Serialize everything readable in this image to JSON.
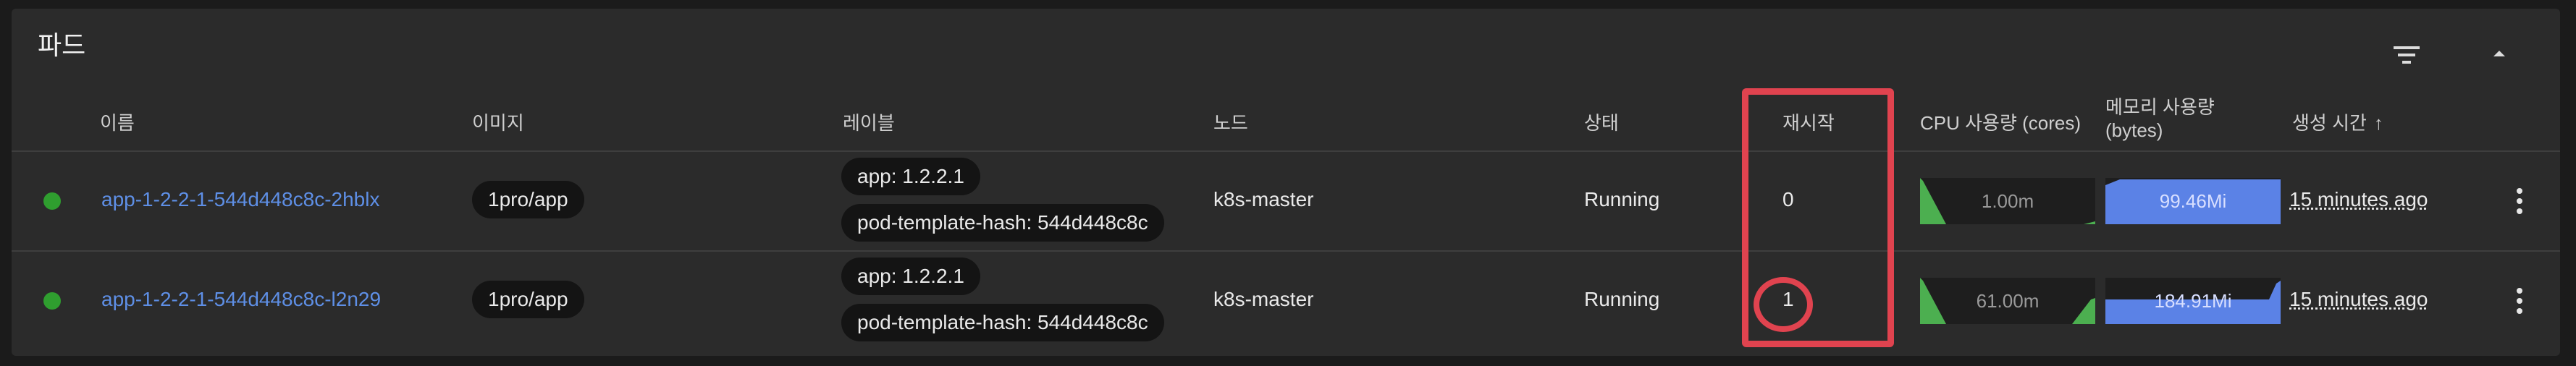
{
  "panel": {
    "title": "파드"
  },
  "columns": {
    "name": "이름",
    "image": "이미지",
    "labels": "레이블",
    "node": "노드",
    "status": "상태",
    "restarts": "재시작",
    "cpu": "CPU 사용량 (cores)",
    "memory_line1": "메모리 사용량",
    "memory_line2": "(bytes)",
    "created": "생성 시간",
    "created_sort": "↑"
  },
  "rows": [
    {
      "name": "app-1-2-2-1-544d448c8c-2hblx",
      "image": "1pro/app",
      "labels": [
        "app: 1.2.2.1",
        "pod-template-hash: 544d448c8c"
      ],
      "node": "k8s-master",
      "status": "Running",
      "restarts": "0",
      "cpu": "1.00m",
      "memory": "99.46Mi",
      "age": "15 minutes ago",
      "status_color": "#2f9e2f"
    },
    {
      "name": "app-1-2-2-1-544d448c8c-l2n29",
      "image": "1pro/app",
      "labels": [
        "app: 1.2.2.1",
        "pod-template-hash: 544d448c8c"
      ],
      "node": "k8s-master",
      "status": "Running",
      "restarts": "1",
      "cpu": "61.00m",
      "memory": "184.91Mi",
      "age": "15 minutes ago",
      "status_color": "#2f9e2f"
    }
  ],
  "colors": {
    "link": "#5e8fe6",
    "running": "#2f9e2f",
    "cpu_chart": "#4caf50",
    "memory_chart": "#5b82e6",
    "annotation": "#e0434f"
  },
  "icons": {
    "filter": "filter-lines-icon",
    "collapse": "triangle-up-icon",
    "menu": "kebab-vertical-icon"
  }
}
